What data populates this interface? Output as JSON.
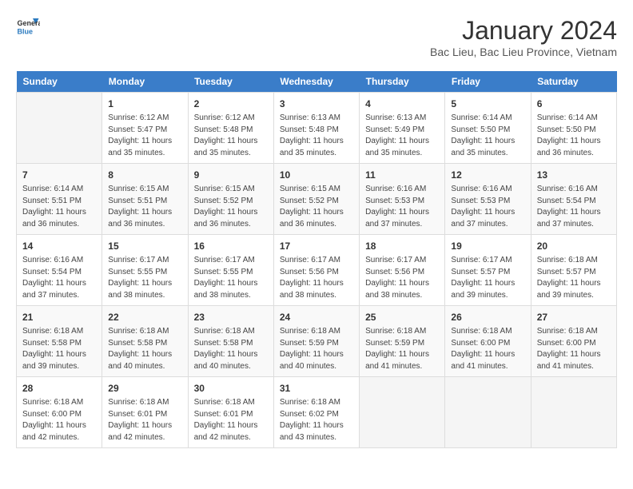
{
  "header": {
    "logo_line1": "General",
    "logo_line2": "Blue",
    "month_title": "January 2024",
    "subtitle": "Bac Lieu, Bac Lieu Province, Vietnam"
  },
  "days_of_week": [
    "Sunday",
    "Monday",
    "Tuesday",
    "Wednesday",
    "Thursday",
    "Friday",
    "Saturday"
  ],
  "weeks": [
    [
      {
        "day": "",
        "info": ""
      },
      {
        "day": "1",
        "info": "Sunrise: 6:12 AM\nSunset: 5:47 PM\nDaylight: 11 hours\nand 35 minutes."
      },
      {
        "day": "2",
        "info": "Sunrise: 6:12 AM\nSunset: 5:48 PM\nDaylight: 11 hours\nand 35 minutes."
      },
      {
        "day": "3",
        "info": "Sunrise: 6:13 AM\nSunset: 5:48 PM\nDaylight: 11 hours\nand 35 minutes."
      },
      {
        "day": "4",
        "info": "Sunrise: 6:13 AM\nSunset: 5:49 PM\nDaylight: 11 hours\nand 35 minutes."
      },
      {
        "day": "5",
        "info": "Sunrise: 6:14 AM\nSunset: 5:50 PM\nDaylight: 11 hours\nand 35 minutes."
      },
      {
        "day": "6",
        "info": "Sunrise: 6:14 AM\nSunset: 5:50 PM\nDaylight: 11 hours\nand 36 minutes."
      }
    ],
    [
      {
        "day": "7",
        "info": "Sunrise: 6:14 AM\nSunset: 5:51 PM\nDaylight: 11 hours\nand 36 minutes."
      },
      {
        "day": "8",
        "info": "Sunrise: 6:15 AM\nSunset: 5:51 PM\nDaylight: 11 hours\nand 36 minutes."
      },
      {
        "day": "9",
        "info": "Sunrise: 6:15 AM\nSunset: 5:52 PM\nDaylight: 11 hours\nand 36 minutes."
      },
      {
        "day": "10",
        "info": "Sunrise: 6:15 AM\nSunset: 5:52 PM\nDaylight: 11 hours\nand 36 minutes."
      },
      {
        "day": "11",
        "info": "Sunrise: 6:16 AM\nSunset: 5:53 PM\nDaylight: 11 hours\nand 37 minutes."
      },
      {
        "day": "12",
        "info": "Sunrise: 6:16 AM\nSunset: 5:53 PM\nDaylight: 11 hours\nand 37 minutes."
      },
      {
        "day": "13",
        "info": "Sunrise: 6:16 AM\nSunset: 5:54 PM\nDaylight: 11 hours\nand 37 minutes."
      }
    ],
    [
      {
        "day": "14",
        "info": "Sunrise: 6:16 AM\nSunset: 5:54 PM\nDaylight: 11 hours\nand 37 minutes."
      },
      {
        "day": "15",
        "info": "Sunrise: 6:17 AM\nSunset: 5:55 PM\nDaylight: 11 hours\nand 38 minutes."
      },
      {
        "day": "16",
        "info": "Sunrise: 6:17 AM\nSunset: 5:55 PM\nDaylight: 11 hours\nand 38 minutes."
      },
      {
        "day": "17",
        "info": "Sunrise: 6:17 AM\nSunset: 5:56 PM\nDaylight: 11 hours\nand 38 minutes."
      },
      {
        "day": "18",
        "info": "Sunrise: 6:17 AM\nSunset: 5:56 PM\nDaylight: 11 hours\nand 38 minutes."
      },
      {
        "day": "19",
        "info": "Sunrise: 6:17 AM\nSunset: 5:57 PM\nDaylight: 11 hours\nand 39 minutes."
      },
      {
        "day": "20",
        "info": "Sunrise: 6:18 AM\nSunset: 5:57 PM\nDaylight: 11 hours\nand 39 minutes."
      }
    ],
    [
      {
        "day": "21",
        "info": "Sunrise: 6:18 AM\nSunset: 5:58 PM\nDaylight: 11 hours\nand 39 minutes."
      },
      {
        "day": "22",
        "info": "Sunrise: 6:18 AM\nSunset: 5:58 PM\nDaylight: 11 hours\nand 40 minutes."
      },
      {
        "day": "23",
        "info": "Sunrise: 6:18 AM\nSunset: 5:58 PM\nDaylight: 11 hours\nand 40 minutes."
      },
      {
        "day": "24",
        "info": "Sunrise: 6:18 AM\nSunset: 5:59 PM\nDaylight: 11 hours\nand 40 minutes."
      },
      {
        "day": "25",
        "info": "Sunrise: 6:18 AM\nSunset: 5:59 PM\nDaylight: 11 hours\nand 41 minutes."
      },
      {
        "day": "26",
        "info": "Sunrise: 6:18 AM\nSunset: 6:00 PM\nDaylight: 11 hours\nand 41 minutes."
      },
      {
        "day": "27",
        "info": "Sunrise: 6:18 AM\nSunset: 6:00 PM\nDaylight: 11 hours\nand 41 minutes."
      }
    ],
    [
      {
        "day": "28",
        "info": "Sunrise: 6:18 AM\nSunset: 6:00 PM\nDaylight: 11 hours\nand 42 minutes."
      },
      {
        "day": "29",
        "info": "Sunrise: 6:18 AM\nSunset: 6:01 PM\nDaylight: 11 hours\nand 42 minutes."
      },
      {
        "day": "30",
        "info": "Sunrise: 6:18 AM\nSunset: 6:01 PM\nDaylight: 11 hours\nand 42 minutes."
      },
      {
        "day": "31",
        "info": "Sunrise: 6:18 AM\nSunset: 6:02 PM\nDaylight: 11 hours\nand 43 minutes."
      },
      {
        "day": "",
        "info": ""
      },
      {
        "day": "",
        "info": ""
      },
      {
        "day": "",
        "info": ""
      }
    ]
  ]
}
